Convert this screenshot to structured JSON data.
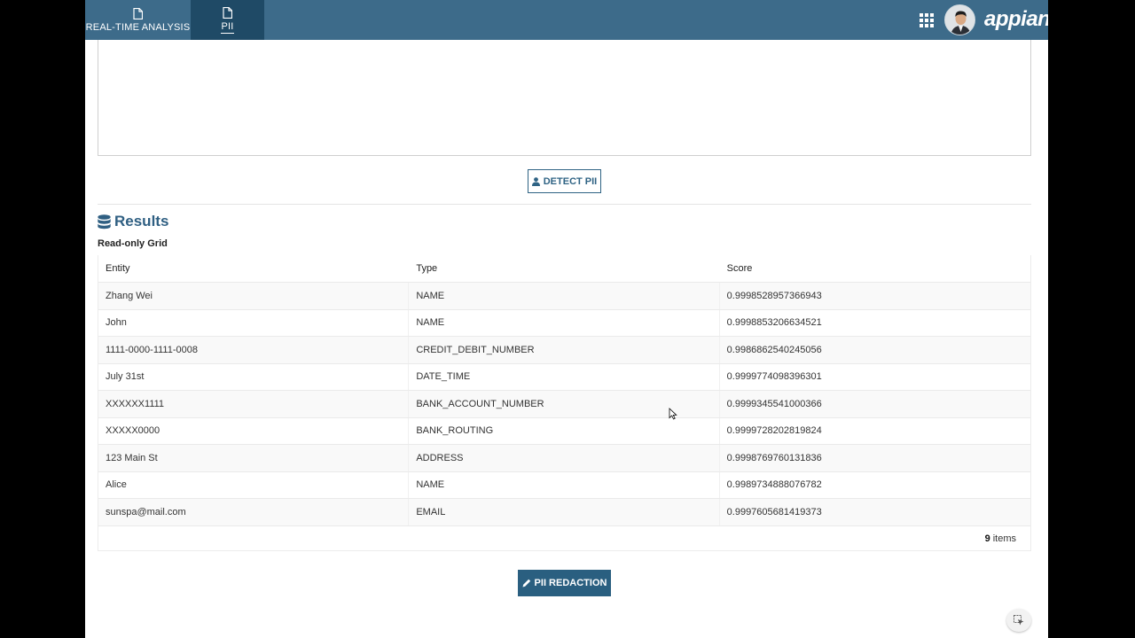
{
  "header": {
    "tabs": [
      {
        "label": "REAL-TIME ANALYSIS",
        "icon": "document-icon",
        "active": false
      },
      {
        "label": "PII",
        "icon": "document-icon",
        "active": true
      }
    ],
    "brand": "appian",
    "colors": {
      "bar": "#3d6b8a",
      "active_tab": "#1f4a66"
    }
  },
  "actions": {
    "detect_label": "DETECT PII",
    "redact_label": "PII REDACTION"
  },
  "results": {
    "heading": "Results",
    "grid_label": "Read-only Grid",
    "columns": [
      "Entity",
      "Type",
      "Score"
    ],
    "rows": [
      {
        "entity": "Zhang Wei",
        "type": "NAME",
        "score": "0.9998528957366943"
      },
      {
        "entity": "John",
        "type": "NAME",
        "score": "0.9998853206634521"
      },
      {
        "entity": "1111-0000-1111-0008",
        "type": "CREDIT_DEBIT_NUMBER",
        "score": "0.9986862540245056"
      },
      {
        "entity": "July 31st",
        "type": "DATE_TIME",
        "score": "0.9999774098396301"
      },
      {
        "entity": "XXXXXX1111",
        "type": "BANK_ACCOUNT_NUMBER",
        "score": "0.9999345541000366"
      },
      {
        "entity": "XXXXX0000",
        "type": "BANK_ROUTING",
        "score": "0.9999728202819824"
      },
      {
        "entity": "123 Main St",
        "type": "ADDRESS",
        "score": "0.9998769760131836"
      },
      {
        "entity": "Alice",
        "type": "NAME",
        "score": "0.9989734888076782"
      },
      {
        "entity": "sunspa@mail.com",
        "type": "EMAIL",
        "score": "0.9997605681419373"
      }
    ],
    "item_count": "9",
    "items_suffix": "items"
  }
}
